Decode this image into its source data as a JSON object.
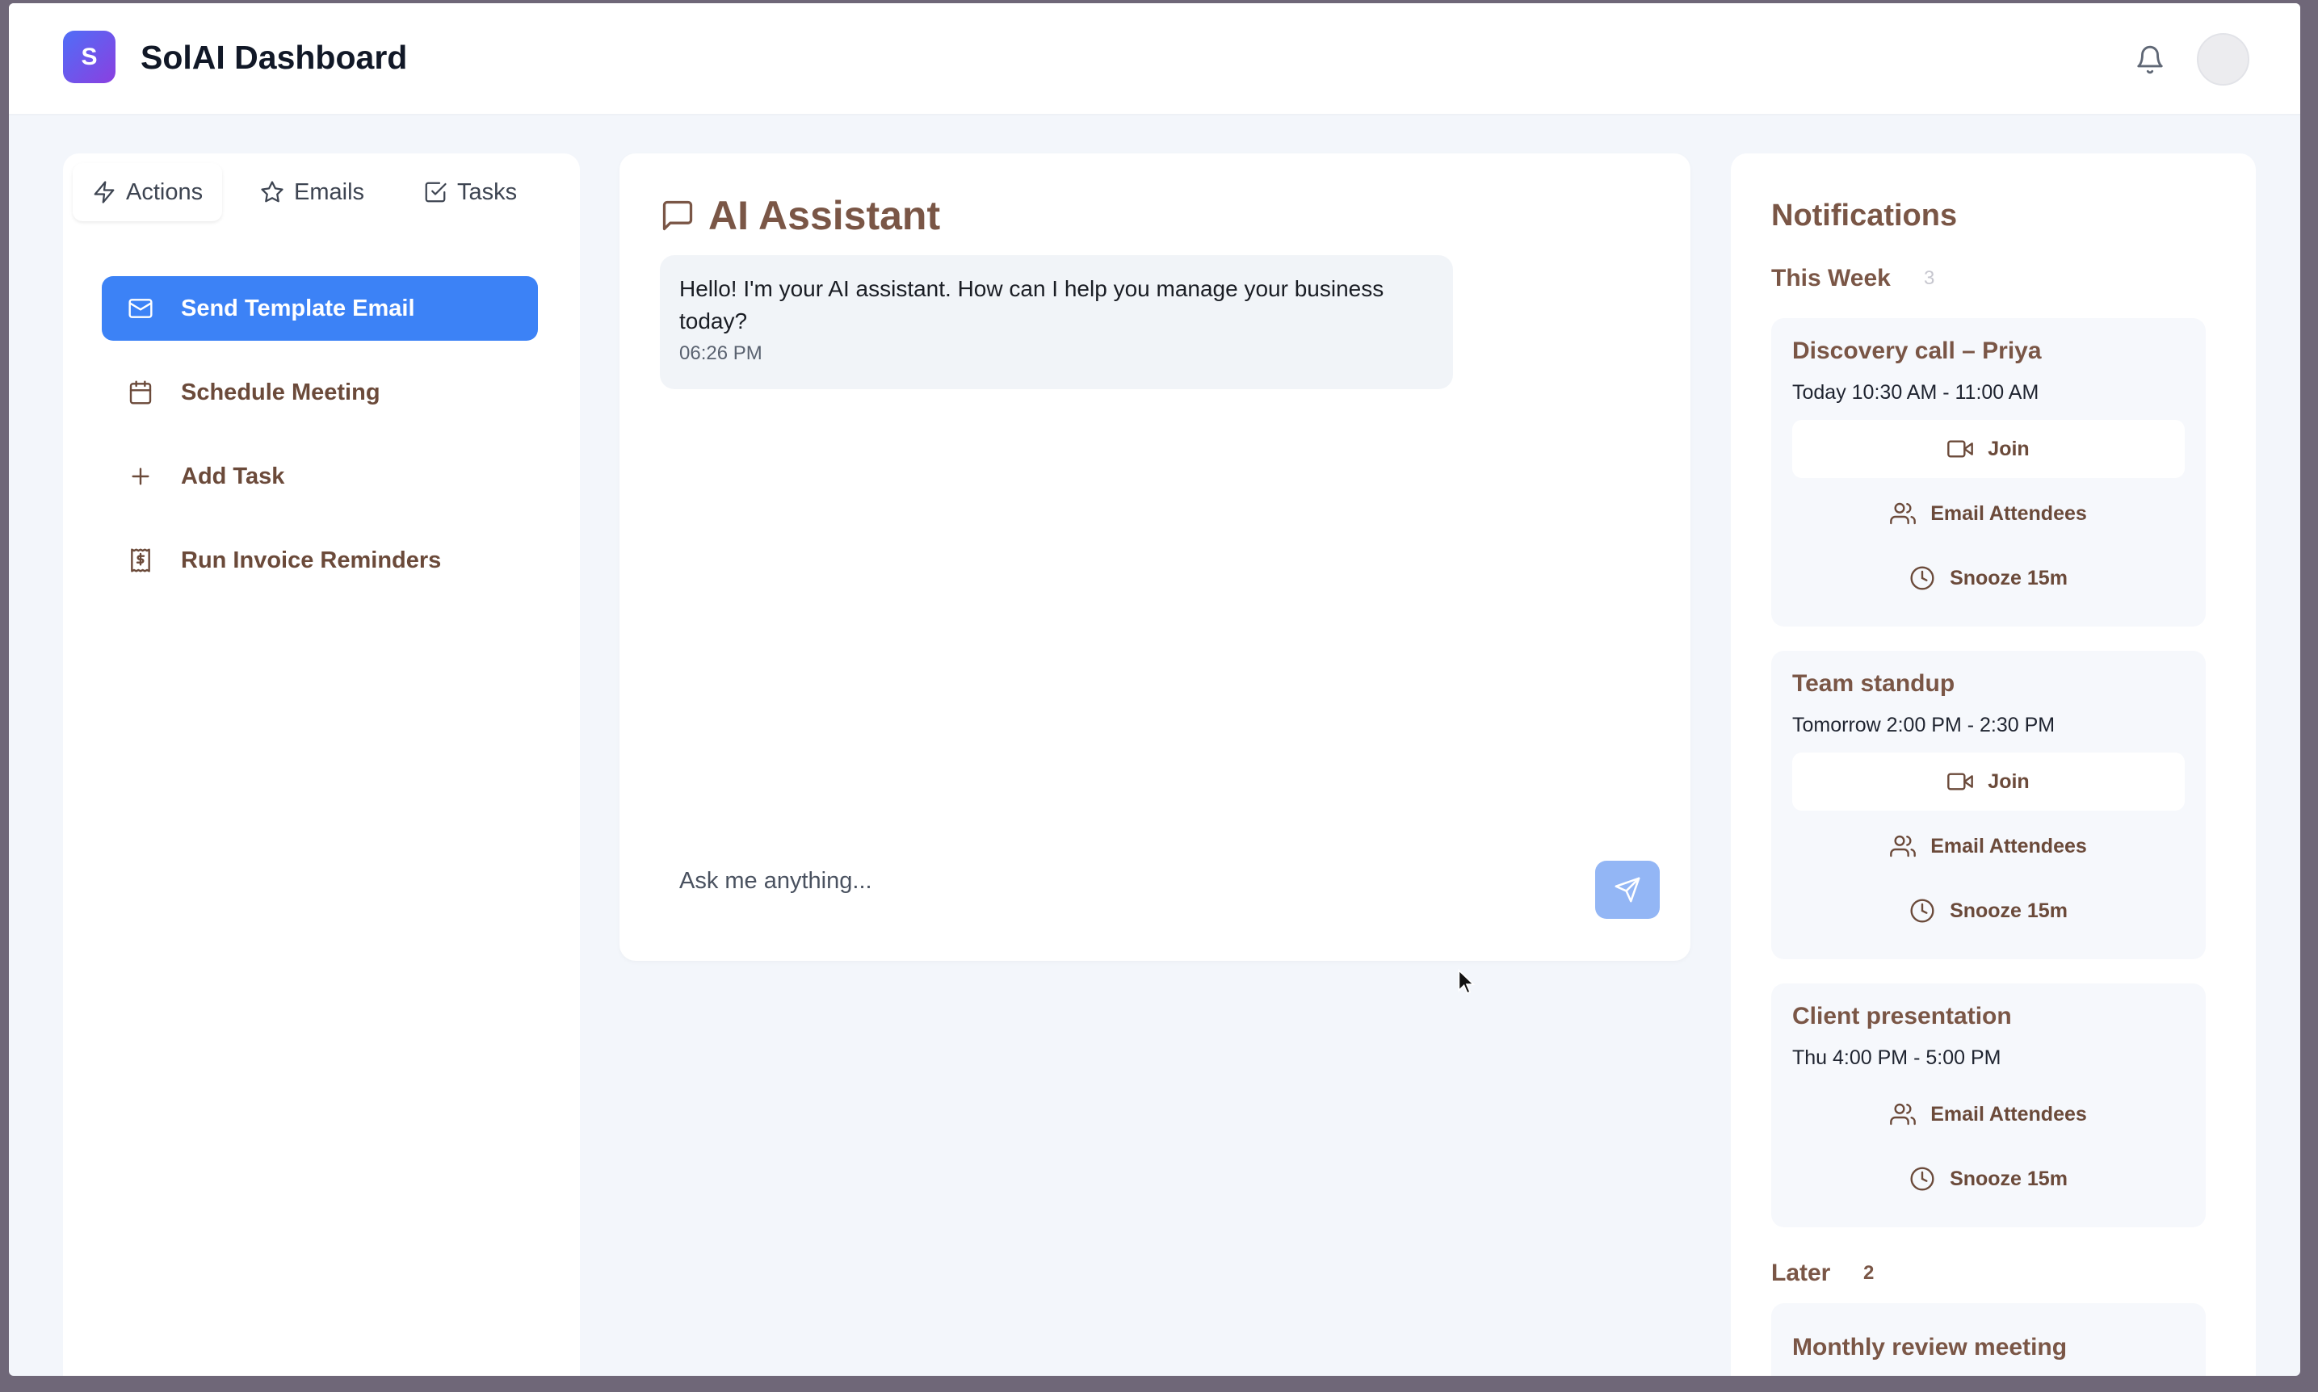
{
  "app": {
    "logo_letter": "S",
    "title": "SolAI Dashboard"
  },
  "left": {
    "tabs": [
      {
        "label": "Actions",
        "icon": "lightning-icon"
      },
      {
        "label": "Emails",
        "icon": "star-icon"
      },
      {
        "label": "Tasks",
        "icon": "checkbox-icon"
      }
    ],
    "actions": [
      {
        "label": "Send Template Email",
        "icon": "mail-icon"
      },
      {
        "label": "Schedule Meeting",
        "icon": "calendar-icon"
      },
      {
        "label": "Add Task",
        "icon": "plus-icon"
      },
      {
        "label": "Run Invoice Reminders",
        "icon": "invoice-icon"
      }
    ]
  },
  "assistant": {
    "title": "AI Assistant",
    "message": "Hello! I'm your AI assistant. How can I help you manage your business today?",
    "time": "06:26 PM",
    "input_placeholder": "Ask me anything..."
  },
  "notifications": {
    "title": "Notifications",
    "this_week": {
      "label": "This Week",
      "count": "3"
    },
    "later": {
      "label": "Later",
      "count": "2"
    },
    "buttons": {
      "join": "Join",
      "email": "Email Attendees",
      "snooze": "Snooze 15m"
    },
    "items": [
      {
        "title": "Discovery call – Priya",
        "time": "Today 10:30 AM - 11:00 AM"
      },
      {
        "title": "Team standup",
        "time": "Tomorrow 2:00 PM - 2:30 PM"
      },
      {
        "title": "Client presentation",
        "time": "Thu 4:00 PM - 5:00 PM"
      }
    ],
    "later_items": [
      {
        "title": "Monthly review meeting"
      }
    ]
  },
  "colors": {
    "primary": "#3c82f6",
    "accent_text": "#7a5646",
    "send_button": "#93b6f5"
  }
}
